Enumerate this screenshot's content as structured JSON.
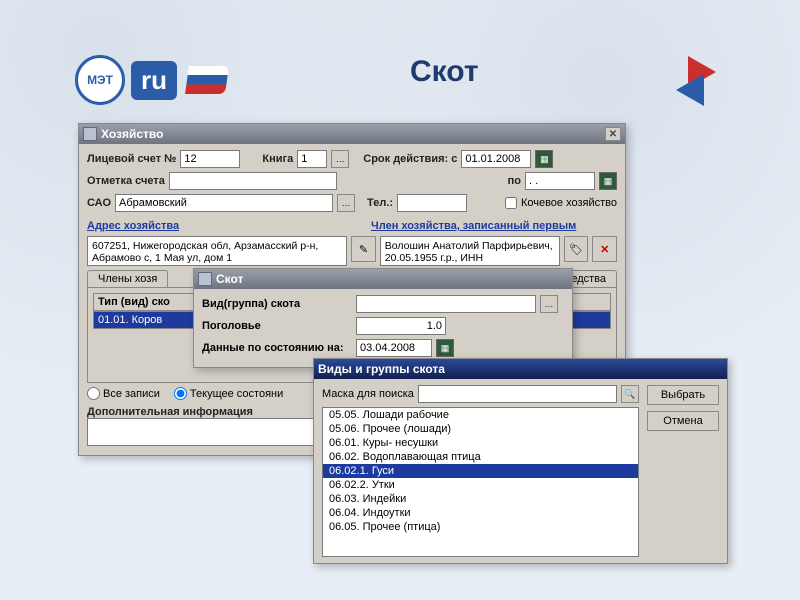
{
  "page": {
    "title": "Скот",
    "logo_text": "ru"
  },
  "win1": {
    "title": "Хозяйство",
    "labels": {
      "personal_account": "Лицевой счет №",
      "book": "Книга",
      "valid_from": "Срок действия: с",
      "valid_to": "по",
      "account_mark": "Отметка счета",
      "sao": "САО",
      "tel": "Тел.:",
      "nomadic": "Кочевое хозяйство",
      "address": "Адрес хозяйства",
      "member_first": "Член хозяйства, записанный первым",
      "tab_members": "Члены хозя",
      "tab_means": "ые средства",
      "col_type": "Тип (вид) ско",
      "all_records": "Все записи",
      "current_state": "Текущее состояни",
      "extra_info": "Дополнительная информация"
    },
    "values": {
      "personal_account": "12",
      "book": "1",
      "valid_from": "01.01.2008",
      "valid_to": ". .",
      "sao": "Абрамовский",
      "address": "607251, Нижегородская обл, Арзамасский р-н, Абрамово с, 1 Мая ул, дом 1",
      "member": "Волошин Анатолий Парфирьевич, 20.05.1955 г.р., ИНН",
      "grid_selected": "01.01. Коров"
    }
  },
  "win2": {
    "title": "Скот",
    "labels": {
      "group": "Вид(группа) скота",
      "headcount": "Поголовье",
      "as_of": "Данные по состоянию на:"
    },
    "values": {
      "headcount": "1.0",
      "as_of": "03.04.2008"
    }
  },
  "win3": {
    "title": "Виды и группы скота",
    "labels": {
      "mask": "Маска для поиска"
    },
    "buttons": {
      "select": "Выбрать",
      "cancel": "Отмена"
    },
    "items": [
      "05.05. Лошади рабочие",
      "05.06. Прочее (лошади)",
      "06.01. Куры- несушки",
      "06.02. Водоплавающая птица",
      "06.02.1. Гуси",
      "06.02.2. Утки",
      "06.03. Индейки",
      "06.04. Индоутки",
      "06.05. Прочее (птица)"
    ],
    "selected_index": 4
  }
}
